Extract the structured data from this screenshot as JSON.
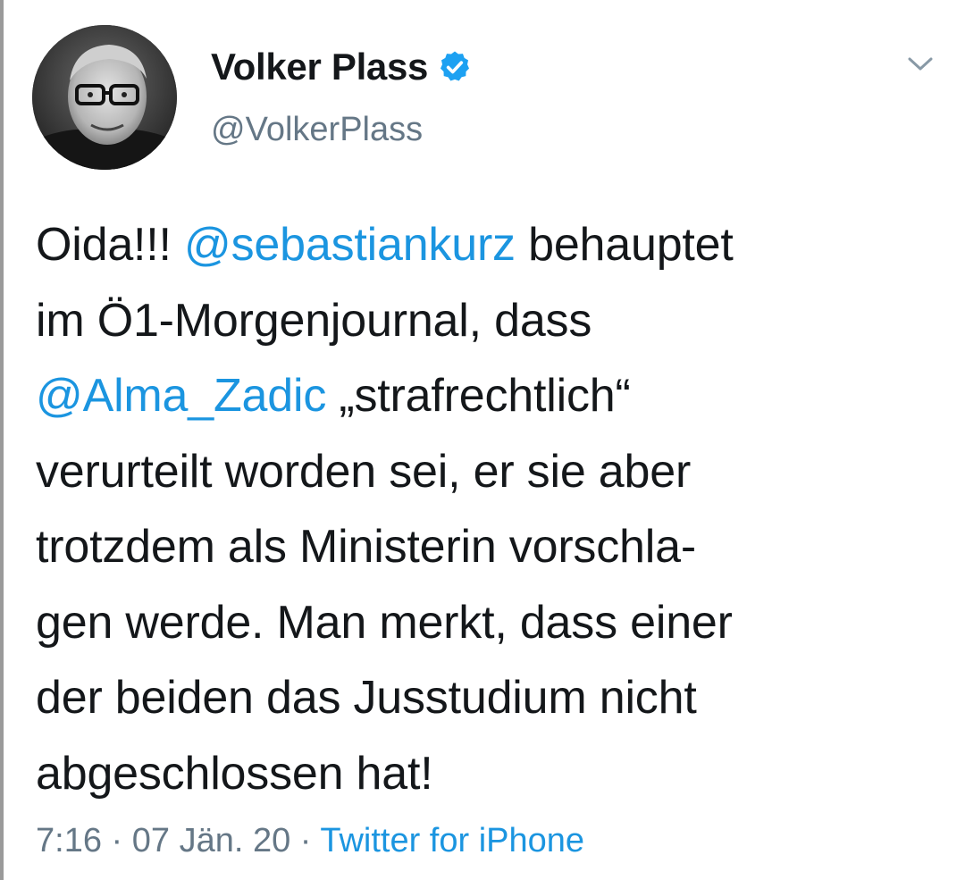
{
  "author": {
    "display_name": "Volker Plass",
    "handle": "@VolkerPlass",
    "verified_icon": "verified-badge-icon",
    "avatar_icon": "profile-photo"
  },
  "menu_icon": "chevron-down-icon",
  "tweet": {
    "lines": [
      {
        "before": "Oida!!! ",
        "mention": "@sebastiankurz",
        "after": " behauptet"
      },
      {
        "before": "im Ö1-Morgenjournal, dass",
        "mention": "",
        "after": ""
      },
      {
        "before": "",
        "mention": "@Alma_Zadic",
        "after": " „strafrechtlich“"
      },
      {
        "before": "verurteilt worden sei, er sie aber",
        "mention": "",
        "after": ""
      },
      {
        "before": "trotzdem als Ministerin vorschla-",
        "mention": "",
        "after": ""
      },
      {
        "before": "gen werde. Man merkt, dass einer",
        "mention": "",
        "after": ""
      },
      {
        "before": "der beiden das Jusstudium nicht",
        "mention": "",
        "after": ""
      },
      {
        "before": "abgeschlossen hat!",
        "mention": "",
        "after": ""
      }
    ]
  },
  "meta": {
    "time": "7:16",
    "separator": "·",
    "date": "07 Jän. 20",
    "source": "Twitter for iPhone"
  },
  "colors": {
    "link": "#1b95e0",
    "text": "#14171a",
    "secondary": "#657786",
    "verified": "#1da1f2"
  }
}
